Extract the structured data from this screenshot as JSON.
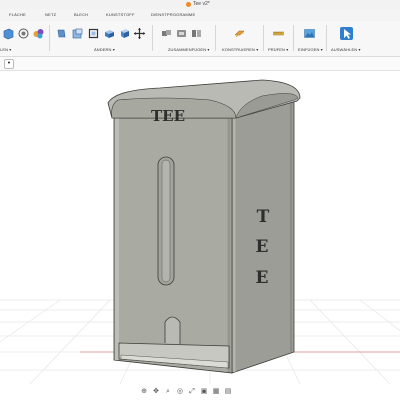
{
  "window": {
    "doc_title": "Tee v2*"
  },
  "tabs": [
    {
      "label": "FLÄCHE"
    },
    {
      "label": "NETZ"
    },
    {
      "label": "BLECH"
    },
    {
      "label": "KUNSTSTOFF"
    },
    {
      "label": "DIENSTPROGRAMME"
    }
  ],
  "ribbon": {
    "groups": [
      {
        "label": "LEN ▾"
      },
      {
        "label": "ÄNDERN ▾"
      },
      {
        "label": "ZUSAMMENFÜGEN ▾"
      },
      {
        "label": "KONSTRUIEREN ▾"
      },
      {
        "label": "PRÜFEN ▾"
      },
      {
        "label": "EINFÜGEN ▾"
      },
      {
        "label": "AUSWÄHLEN ▾"
      }
    ]
  },
  "browser": {
    "toggle_glyph": "•"
  },
  "model": {
    "front_text": "TEE",
    "side_letters": [
      "T",
      "E",
      "E"
    ],
    "colors": {
      "body": "#a9aaa2",
      "body_dark": "#8e8f88",
      "body_light": "#c2c3bc",
      "edge": "#3d3d3a"
    }
  },
  "navbar": {
    "icons": [
      "orbit-icon",
      "pan-icon",
      "zoom-icon",
      "look-icon",
      "fit-icon",
      "display-icon",
      "grid-icon",
      "view-icon"
    ]
  }
}
